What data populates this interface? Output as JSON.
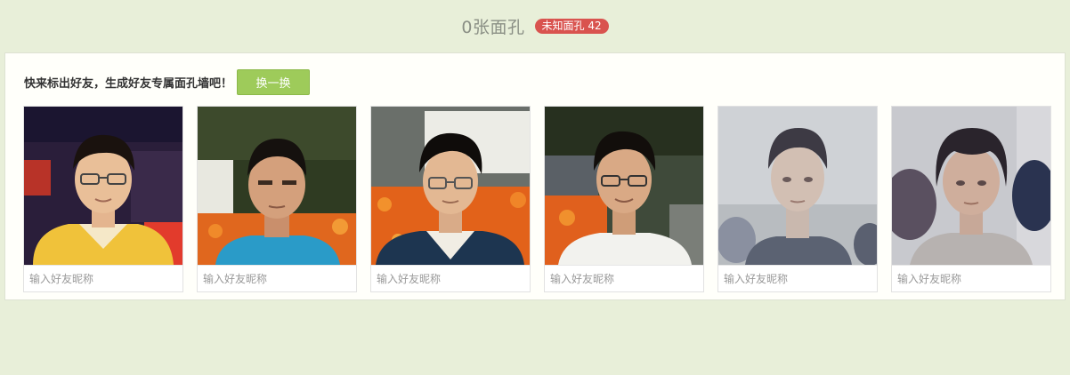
{
  "header": {
    "title": "0张面孔",
    "badge": "未知面孔 42"
  },
  "panel": {
    "prompt": "快来标出好友，生成好友专属面孔墙吧！",
    "swap_label": "换一换"
  },
  "faces": [
    {
      "placeholder": "输入好友昵称"
    },
    {
      "placeholder": "输入好友昵称"
    },
    {
      "placeholder": "输入好友昵称"
    },
    {
      "placeholder": "输入好友昵称"
    },
    {
      "placeholder": "输入好友昵称"
    },
    {
      "placeholder": "输入好友昵称"
    }
  ],
  "colors": {
    "page_background": "#e8efd9",
    "badge": "#d9534f",
    "button": "#9ecb5a"
  }
}
